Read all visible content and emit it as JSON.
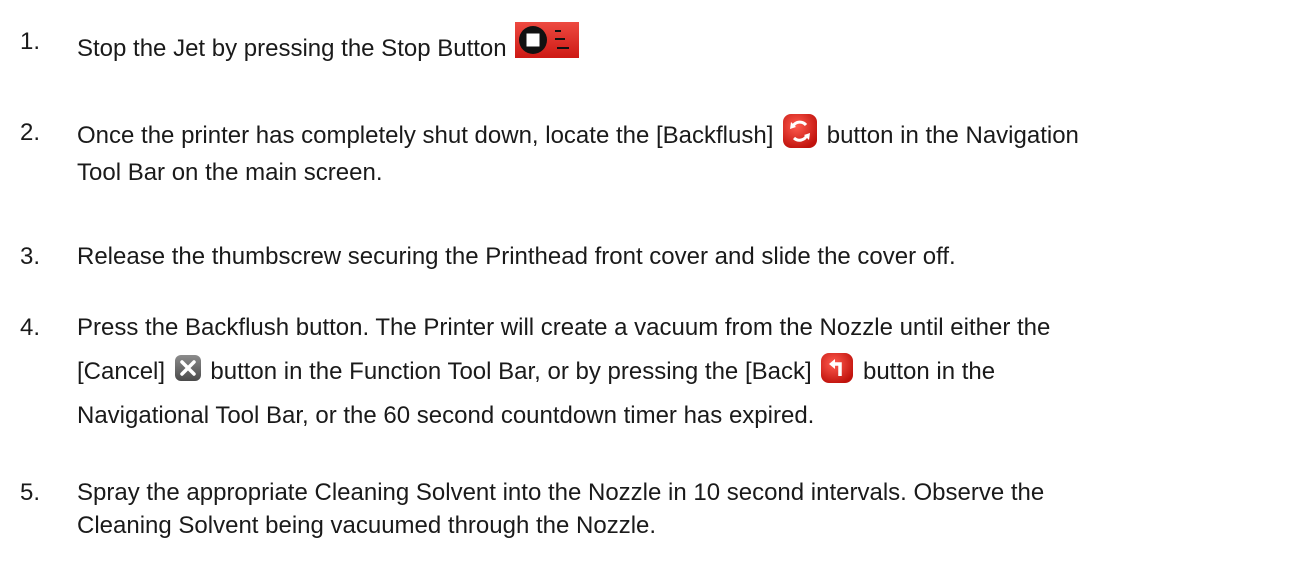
{
  "steps": [
    {
      "number": "1.",
      "parts": [
        "Stop the Jet by pressing the Stop Button"
      ],
      "icons": [
        "stop-jet-button-icon"
      ]
    },
    {
      "number": "2.",
      "parts": [
        "Once the printer has completely shut down, locate the [Backflush]",
        "button in the Navigation",
        "Tool Bar on the main screen."
      ],
      "icons": [
        "backflush-button-icon"
      ]
    },
    {
      "number": "3.",
      "parts": [
        "Release the thumbscrew securing the Printhead front cover and slide the cover off."
      ]
    },
    {
      "number": "4.",
      "parts": [
        "Press the Backflush button. The Printer will create a vacuum from the Nozzle until either the",
        "[Cancel]",
        "button in the Function Tool Bar, or by pressing the [Back]",
        "button in the",
        "Navigational Tool Bar, or the 60 second countdown timer has expired."
      ],
      "icons": [
        "cancel-button-icon",
        "back-button-icon"
      ]
    },
    {
      "number": "5.",
      "parts": [
        "Spray the appropriate Cleaning Solvent into the Nozzle in 10 second intervals. Observe the",
        "Cleaning Solvent being vacuumed through the Nozzle."
      ]
    }
  ],
  "colors": {
    "text": "#1a1a1a",
    "icon_red": "#e0201c",
    "icon_gray": "#6b6b6b"
  }
}
